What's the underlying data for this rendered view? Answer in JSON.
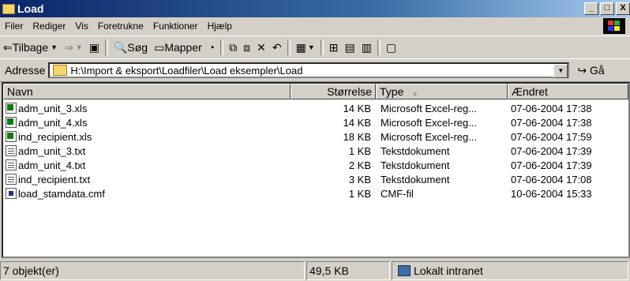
{
  "window": {
    "title": "Load",
    "min": "_",
    "max": "□",
    "close": "X"
  },
  "menu": [
    "Filer",
    "Rediger",
    "Vis",
    "Foretrukne",
    "Funktioner",
    "Hjælp"
  ],
  "toolbar": {
    "back_label": "Tilbage",
    "search_label": "Søg",
    "folders_label": "Mapper"
  },
  "address": {
    "label": "Adresse",
    "value": "H:\\Import & eksport\\Loadfiler\\Load eksempler\\Load",
    "go_label": "Gå"
  },
  "columns": {
    "name": "Navn",
    "size": "Størrelse",
    "type": "Type",
    "modified": "Ændret"
  },
  "files": [
    {
      "icon": "excel-file-icon",
      "name": "adm_unit_3.xls",
      "size": "14 KB",
      "type": "Microsoft Excel-reg...",
      "modified": "07-06-2004 17:38"
    },
    {
      "icon": "excel-file-icon",
      "name": "adm_unit_4.xls",
      "size": "14 KB",
      "type": "Microsoft Excel-reg...",
      "modified": "07-06-2004 17:38"
    },
    {
      "icon": "excel-file-icon",
      "name": "ind_recipient.xls",
      "size": "18 KB",
      "type": "Microsoft Excel-reg...",
      "modified": "07-06-2004 17:59"
    },
    {
      "icon": "text-file-icon",
      "name": "adm_unit_3.txt",
      "size": "1 KB",
      "type": "Tekstdokument",
      "modified": "07-06-2004 17:39"
    },
    {
      "icon": "text-file-icon",
      "name": "adm_unit_4.txt",
      "size": "2 KB",
      "type": "Tekstdokument",
      "modified": "07-06-2004 17:39"
    },
    {
      "icon": "text-file-icon",
      "name": "ind_recipient.txt",
      "size": "3 KB",
      "type": "Tekstdokument",
      "modified": "07-06-2004 17:08"
    },
    {
      "icon": "cmf-file-icon",
      "name": "load_stamdata.cmf",
      "size": "1 KB",
      "type": "CMF-fil",
      "modified": "10-06-2004 15:33"
    }
  ],
  "status": {
    "count": "7 objekt(er)",
    "size": "49,5 KB",
    "zone": "Lokalt intranet"
  }
}
